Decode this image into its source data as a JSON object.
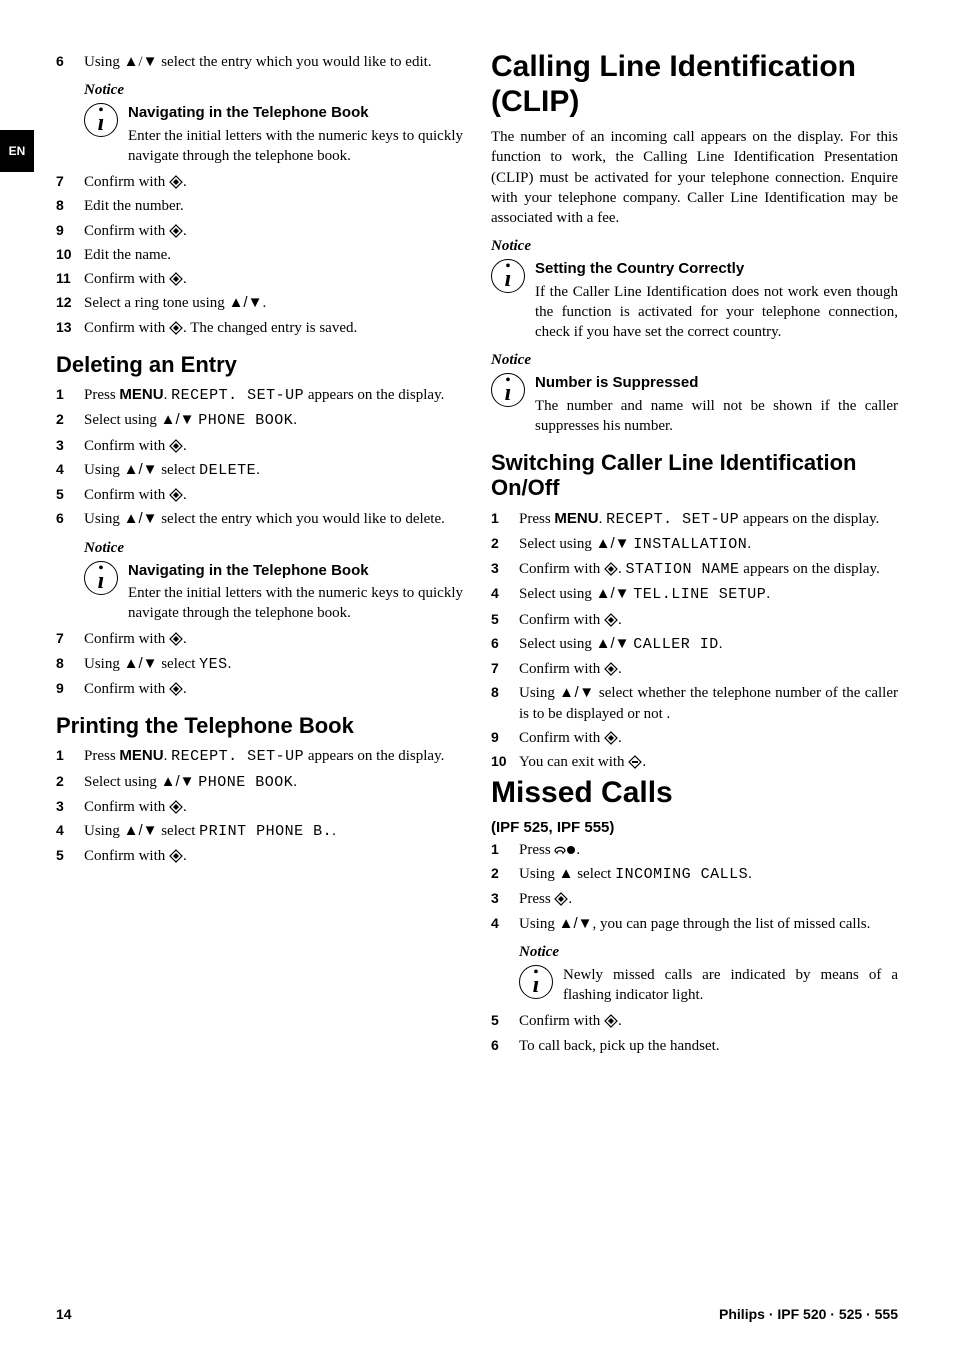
{
  "side_tab": "EN",
  "symbols": {
    "updown": "▲/▼",
    "up": "▲",
    "diamond_start": "◈",
    "diamond_stop": "◎",
    "caller": "☎●"
  },
  "left": {
    "step6_pre": "Using ▲/▼ select the entry which you would like to edit.",
    "notice1": {
      "label": "Notice",
      "title": "Navigating in the Telephone Book",
      "body": "Enter the initial letters with the numeric keys to quickly navigate through the telephone book."
    },
    "steps_a": [
      {
        "n": "7",
        "t": "Confirm with ◈."
      },
      {
        "n": "8",
        "t": "Edit the number."
      },
      {
        "n": "9",
        "t": "Confirm with ◈."
      },
      {
        "n": "10",
        "t": "Edit the name."
      },
      {
        "n": "11",
        "t": "Confirm with ◈."
      },
      {
        "n": "12",
        "t": "Select a ring tone using ▲/▼."
      },
      {
        "n": "13",
        "t": "Confirm with ◈. The changed entry is saved."
      }
    ],
    "h_delete": "Deleting an Entry",
    "steps_b": [
      {
        "n": "1",
        "t": "Press <strong class='menu'>MENU</strong>. <span class='lcd'>RECEPT. SET-UP</span> appears on the display."
      },
      {
        "n": "2",
        "t": "Select using ▲/▼ <span class='lcd'>PHONE BOOK</span>."
      },
      {
        "n": "3",
        "t": "Confirm with ◈."
      },
      {
        "n": "4",
        "t": "Using ▲/▼ select <span class='lcd'>DELETE</span>."
      },
      {
        "n": "5",
        "t": "Confirm with ◈."
      },
      {
        "n": "6",
        "t": "Using ▲/▼ select the entry which you would like to delete."
      }
    ],
    "notice2": {
      "label": "Notice",
      "title": "Navigating in the Telephone Book",
      "body": "Enter the initial letters with the numeric keys to quickly navigate through the telephone book."
    },
    "steps_c": [
      {
        "n": "7",
        "t": "Confirm with ◈."
      },
      {
        "n": "8",
        "t": "Using ▲/▼ select <span class='lcd'>YES</span>."
      },
      {
        "n": "9",
        "t": "Confirm with ◈."
      }
    ],
    "h_print": "Printing the Telephone Book",
    "steps_d": [
      {
        "n": "1",
        "t": "Press <strong class='menu'>MENU</strong>. <span class='lcd'>RECEPT. SET-UP</span> appears on the display."
      },
      {
        "n": "2",
        "t": "Select using ▲/▼ <span class='lcd'>PHONE BOOK</span>."
      },
      {
        "n": "3",
        "t": "Confirm with ◈."
      },
      {
        "n": "4",
        "t": "Using ▲/▼ select <span class='lcd'>PRINT PHONE B.</span>."
      },
      {
        "n": "5",
        "t": "Confirm with ◈."
      }
    ]
  },
  "right": {
    "h_clip": "Calling Line Identification (CLIP)",
    "clip_body": "The number of an incoming call appears on the display. For this function to work, the Calling Line Identification Presentation (CLIP) must be activated for your telephone connection. Enquire with your telephone company. Caller Line Identification may be associated with a fee.",
    "notice1": {
      "label": "Notice",
      "title": "Setting the Country Correctly",
      "body": "If the Caller Line Identification does not work even though the function is activated for your telephone connection, check if you have set the correct country."
    },
    "notice2": {
      "label": "Notice",
      "title": "Number is Suppressed",
      "body": "The number and name will not be shown if the caller suppresses his number."
    },
    "h_switch": "Switching Caller Line Identification On/Off",
    "steps_e": [
      {
        "n": "1",
        "t": "Press <strong class='menu'>MENU</strong>. <span class='lcd'>RECEPT. SET-UP</span> appears on the display."
      },
      {
        "n": "2",
        "t": "Select using ▲/▼ <span class='lcd'>INSTALLATION</span>."
      },
      {
        "n": "3",
        "t": "Confirm with ◈. <span class='lcd'>STATION NAME</span> appears on the display."
      },
      {
        "n": "4",
        "t": "Select using ▲/▼ <span class='lcd'>TEL.LINE SETUP</span>."
      },
      {
        "n": "5",
        "t": "Confirm with ◈."
      },
      {
        "n": "6",
        "t": "Select using ▲/▼ <span class='lcd'>CALLER ID</span>."
      },
      {
        "n": "7",
        "t": "Confirm with ◈."
      },
      {
        "n": "8",
        "t": "Using ▲/▼ select whether the telephone number of the caller is to be displayed or not ."
      },
      {
        "n": "9",
        "t": "Confirm with ◈."
      },
      {
        "n": "10",
        "t": "You can exit with ◎."
      }
    ],
    "h_missed": "Missed Calls",
    "missed_model": "(IPF 525, IPF 555)",
    "steps_f": [
      {
        "n": "1",
        "t": "Press "
      },
      {
        "n": "2",
        "t": "Using ▲ select <span class='lcd'>INCOMING CALLS</span>."
      },
      {
        "n": "3",
        "t": "Press ◈."
      },
      {
        "n": "4",
        "t": "Using ▲/▼, you can page through the list of missed calls."
      }
    ],
    "notice3": {
      "label": "Notice",
      "body": "Newly missed calls are indicated by means of a flashing indicator light."
    },
    "steps_g": [
      {
        "n": "5",
        "t": "Confirm with ◈."
      },
      {
        "n": "6",
        "t": "To call back, pick up the handset."
      }
    ]
  },
  "footer": {
    "page": "14",
    "right": "Philips · IPF 520 · 525 · 555"
  }
}
